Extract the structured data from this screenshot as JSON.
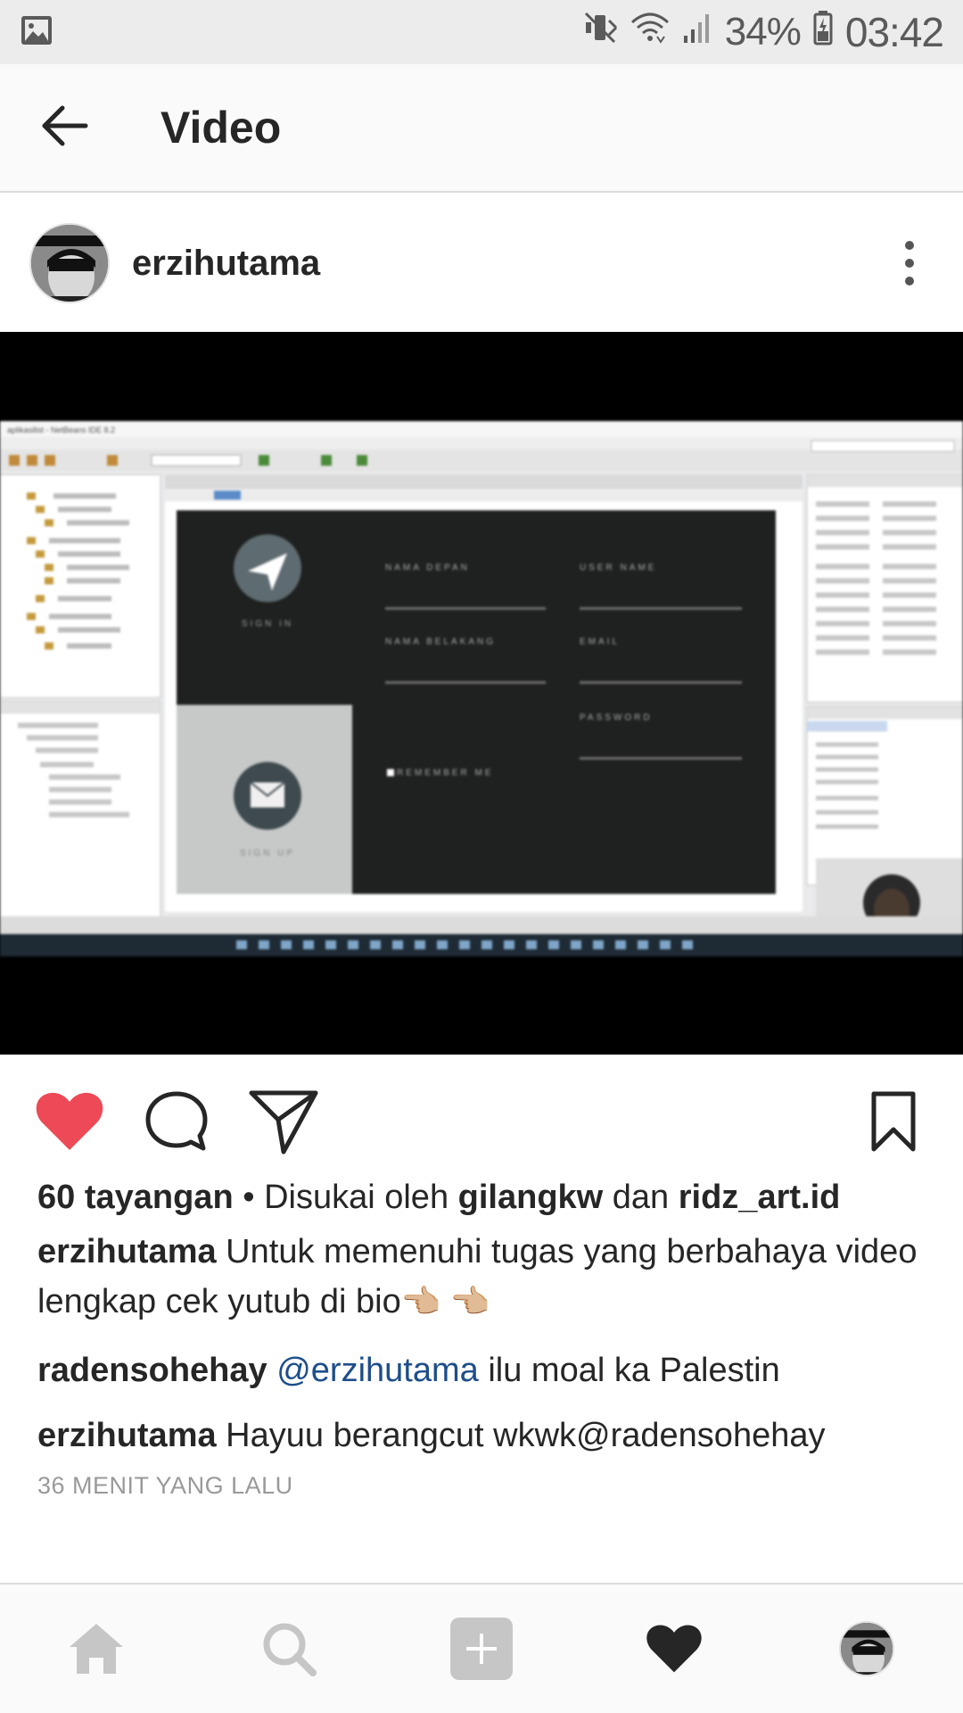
{
  "status_bar": {
    "battery": "34%",
    "time": "03:42",
    "icons": [
      "image-icon",
      "mute-icon",
      "wifi-icon",
      "signal-icon",
      "battery-icon"
    ]
  },
  "header": {
    "title": "Video",
    "back_icon": "arrow-left-icon"
  },
  "post": {
    "username": "erzihutama",
    "more_icon": "more-vertical-icon",
    "video": {
      "app_title": "aplikasilist - NetBeans IDE 8.2",
      "form_labels": [
        "NAMA DEPAN",
        "USER NAME",
        "NAMA BELAKANG",
        "EMAIL",
        "PASSWORD",
        "REMEMBER ME",
        "SIGN IN",
        "SIGN UP"
      ]
    },
    "actions": [
      "heart-icon",
      "comment-icon",
      "share-icon",
      "bookmark-icon"
    ],
    "colors": {
      "like": "#ed4956",
      "link": "#1d4e8a"
    },
    "views": {
      "count": "60 tayangan",
      "separator": " • Disukai oleh ",
      "liker1": "gilangkw",
      "and": " dan ",
      "liker2": "ridz_art.id"
    },
    "caption": {
      "user": "erzihutama",
      "text": " Untuk memenuhi tugas yang berbahaya video lengkap cek yutub di bio",
      "emoji": "👈🏼 👈🏼"
    },
    "comments": [
      {
        "user": "radensohehay",
        "mention": " @erzihutama",
        "text": " ilu moal ka Palestin"
      },
      {
        "user": "erzihutama",
        "mention": "",
        "text": " Hayuu berangcut wkwk@radensohehay"
      }
    ],
    "timestamp": "36 MENIT YANG LALU"
  },
  "bottom_nav": {
    "items": [
      "home-icon",
      "search-icon",
      "add-post-icon",
      "activity-heart-icon",
      "profile-avatar"
    ]
  }
}
